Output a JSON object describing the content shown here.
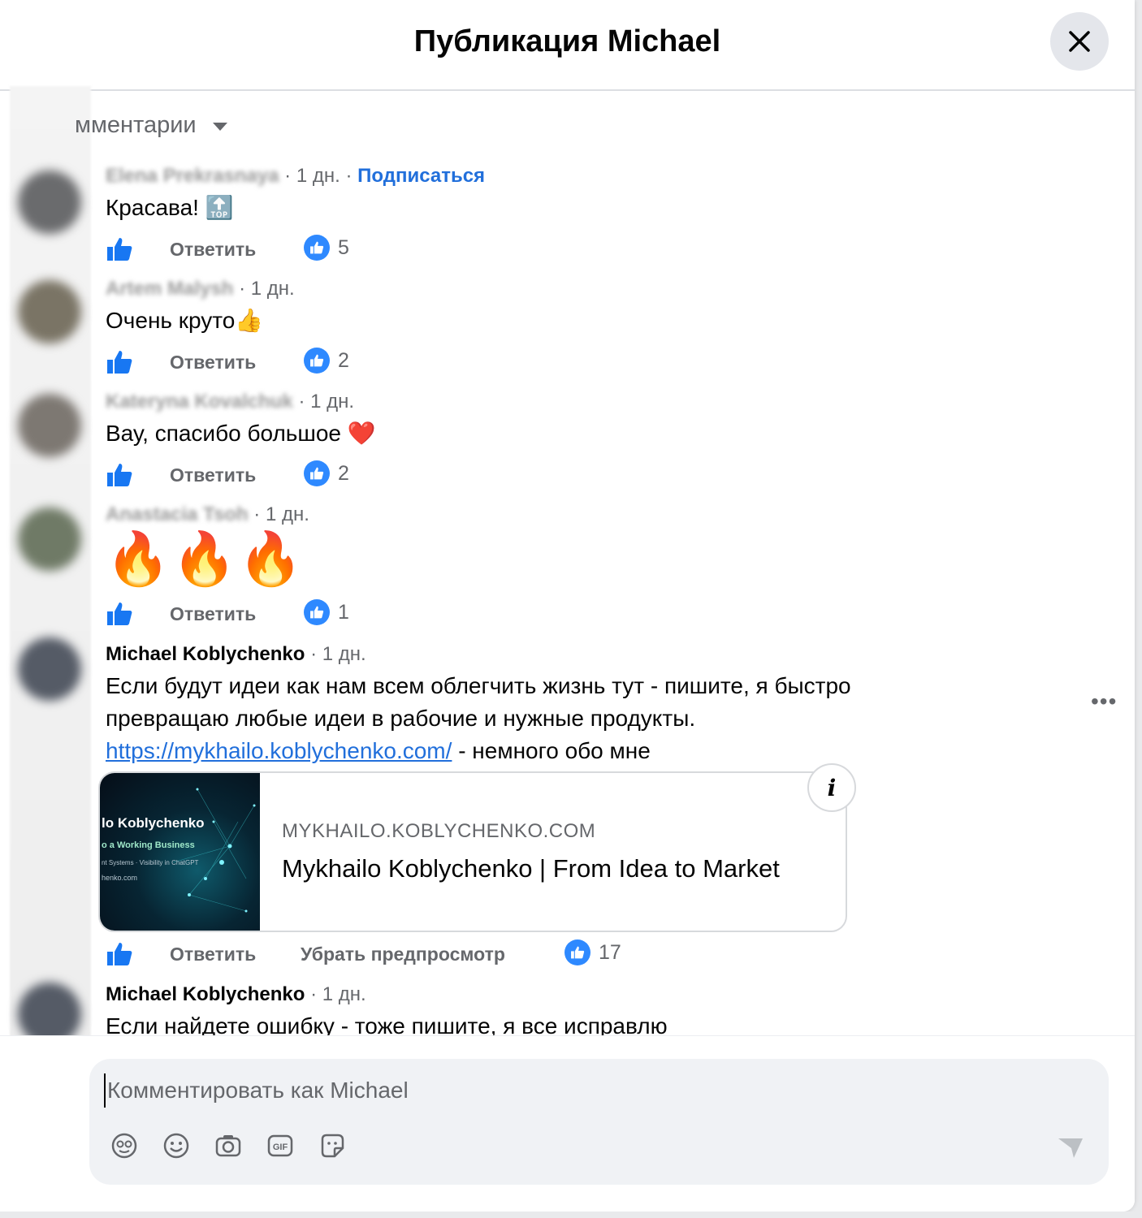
{
  "header": {
    "title": "Публикация Michael"
  },
  "sort": {
    "label": "мментарии"
  },
  "comments": [
    {
      "name": "Elena Prekrasnaya",
      "time": "1 дн.",
      "subscribe": "Подписаться",
      "text": "Красава! 🔝",
      "reply": "Ответить",
      "likes": "5"
    },
    {
      "name": "Artem Malysh",
      "time": "1 дн.",
      "text": "Очень круто👍",
      "reply": "Ответить",
      "likes": "2"
    },
    {
      "name": "Kateryna Kovalchuk",
      "time": "1 дн.",
      "text": "Вау, спасибо большое ❤️",
      "reply": "Ответить",
      "likes": "2"
    },
    {
      "name": "Anastacia Tsoh",
      "time": "1 дн.",
      "text": "🔥🔥🔥",
      "reply": "Ответить",
      "likes": "1"
    },
    {
      "name": "Michael Koblychenko",
      "time": "1 дн.",
      "line1": "Если будут идеи как нам всем облегчить жизнь тут - пишите, я быстро",
      "line2": "превращаю любые идеи в рабочие и нужные продукты.",
      "link": "https://mykhailo.koblychenko.com/",
      "link_suffix": " - немного обо мне",
      "reply": "Ответить",
      "remove_preview": "Убрать предпросмотр",
      "likes": "17",
      "preview": {
        "domain": "MYKHAILO.KOBLYCHENKO.COM",
        "title": "Mykhailo Koblychenko | From Idea to Market",
        "img_title": "lo Koblychenko",
        "img_sub": "o a Working Business",
        "img_line": "nt Systems · Visibility in ChatGPT",
        "img_url": "henko.com"
      }
    },
    {
      "name": "Michael Koblychenko",
      "time": "1 дн.",
      "text": "Если найдете ошибку - тоже пишите, я все исправлю"
    }
  ],
  "composer": {
    "placeholder": "Комментировать как Michael"
  },
  "icons": [
    "avatar-sticker-icon",
    "emoji-icon",
    "camera-icon",
    "gif-icon",
    "sticker-icon",
    "send-icon"
  ],
  "colors": {
    "accent": "#216fdb",
    "like": "#2e89ff",
    "muted": "#65676b"
  }
}
